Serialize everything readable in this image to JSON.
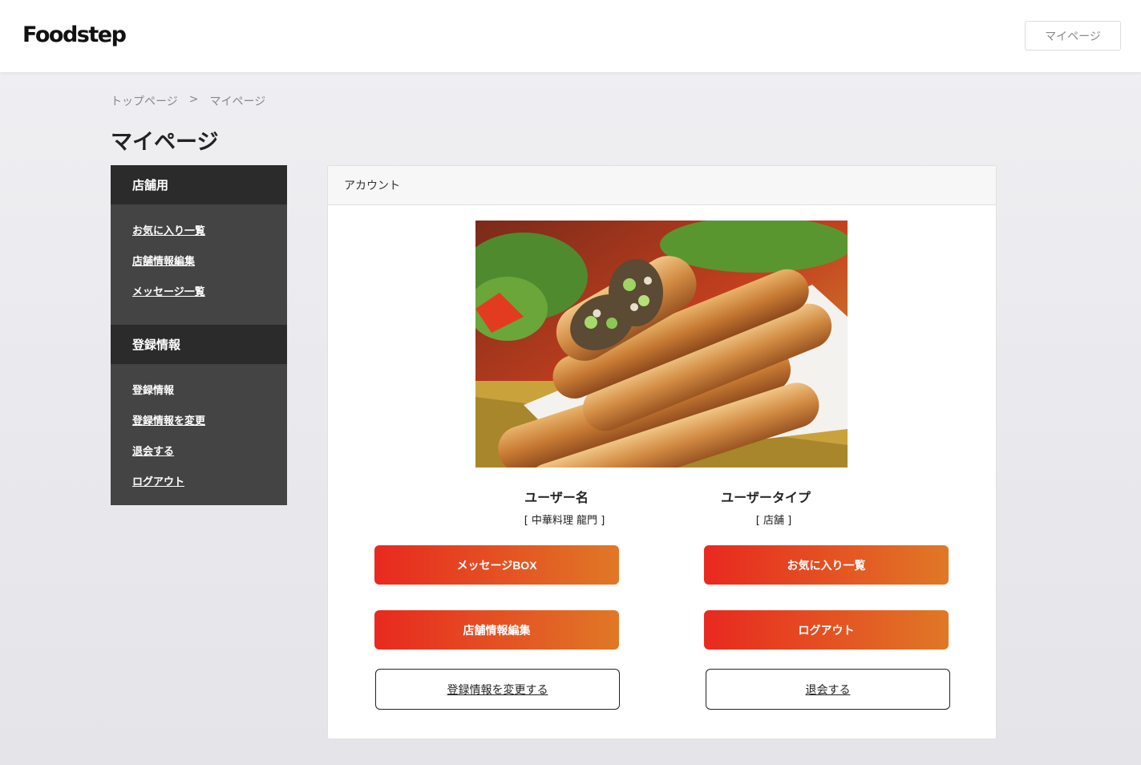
{
  "header": {
    "logo": "Foodstep",
    "mypage_button": "マイページ"
  },
  "breadcrumb": {
    "top": "トップページ",
    "separator": ">",
    "current": "マイページ"
  },
  "page_title": "マイページ",
  "sidebar": {
    "store_section": {
      "title": "店舗用",
      "items": [
        "お気に入り一覧",
        "店舗情報編集",
        "メッセージ一覧"
      ]
    },
    "account_section": {
      "title": "登録情報",
      "items": [
        "登録情報",
        "登録情報を変更",
        "退会する",
        "ログアウト"
      ]
    }
  },
  "account_card": {
    "header": "アカウント",
    "user_name_label": "ユーザー名",
    "user_name_value": "[ 中華料理 龍門 ]",
    "user_type_label": "ユーザータイプ",
    "user_type_value": "[ 店舗 ]",
    "buttons": {
      "message_box": "メッセージBOX",
      "favorites": "お気に入り一覧",
      "edit_store": "店舗情報編集",
      "logout": "ログアウト",
      "change_info": "登録情報を変更する",
      "withdraw": "退会する"
    }
  },
  "colors": {
    "sidebar_bg": "#444444",
    "sidebar_head_bg": "#2b2b2b",
    "button_gradient_start": "#e8291f",
    "button_gradient_end": "#e07826"
  }
}
